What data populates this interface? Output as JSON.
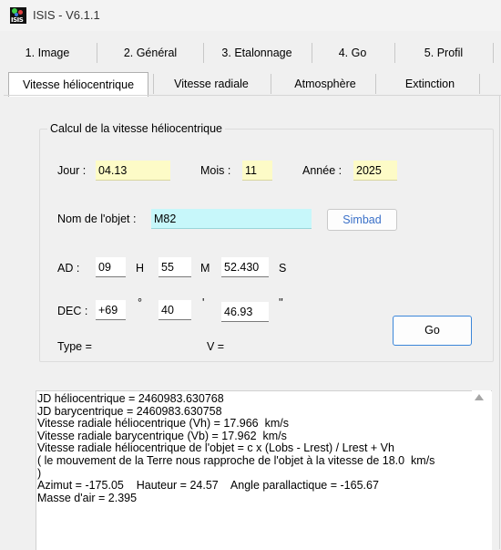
{
  "window": {
    "title": "ISIS - V6.1.1",
    "icon": "isis-app-icon",
    "icon_text": "ISIS"
  },
  "main_tabs": [
    {
      "label": "1. Image"
    },
    {
      "label": "2. Général"
    },
    {
      "label": "3. Etalonnage"
    },
    {
      "label": "4. Go"
    },
    {
      "label": "5. Profil"
    }
  ],
  "sub_tabs": [
    {
      "label": "Vitesse héliocentrique",
      "active": true
    },
    {
      "label": "Vitesse radiale"
    },
    {
      "label": "Atmosphère"
    },
    {
      "label": "Extinction"
    }
  ],
  "group": {
    "title": "Calcul de la vitesse héliocentrique",
    "jour_label": "Jour :",
    "jour_value": "04.13",
    "mois_label": "Mois :",
    "mois_value": "11",
    "annee_label": "Année :",
    "annee_value": "2025",
    "nom_label": "Nom de l'objet :",
    "nom_value": "M82",
    "simbad_label": "Simbad",
    "ad_label": "AD :",
    "ad_h_value": "09",
    "ad_h_unit": "H",
    "ad_m_value": "55",
    "ad_m_unit": "M",
    "ad_s_value": "52.430",
    "ad_s_unit": "S",
    "dec_label": "DEC :",
    "dec_deg_value": "+69",
    "dec_deg_unit": "°",
    "dec_min_value": "40",
    "dec_min_unit": "'",
    "dec_sec_value": "46.93",
    "dec_sec_unit": "''",
    "go_label": "Go",
    "type_label": "Type =",
    "v_label": "V ="
  },
  "output": {
    "text": "JD héliocentrique = 2460983.630768\nJD barycentrique = 2460983.630758\nVitesse radiale héliocentrique (Vh) = 17.966  km/s\nVitesse radiale barycentrique (Vb) = 17.962  km/s\nVitesse radiale héliocentrique de l'objet = c x (Lobs - Lrest) / Lrest + Vh\n( le mouvement de la Terre nous rapproche de l'objet à la vitesse de 18.0  km/s\n)\nAzimut = -175.05    Hauteur = 24.57    Angle parallactique = -165.67\nMasse d'air = 2.395"
  },
  "colors": {
    "yellow_field": "#fdfbc7",
    "cyan_field": "#c7f7fa",
    "go_border": "#3b86d9"
  }
}
